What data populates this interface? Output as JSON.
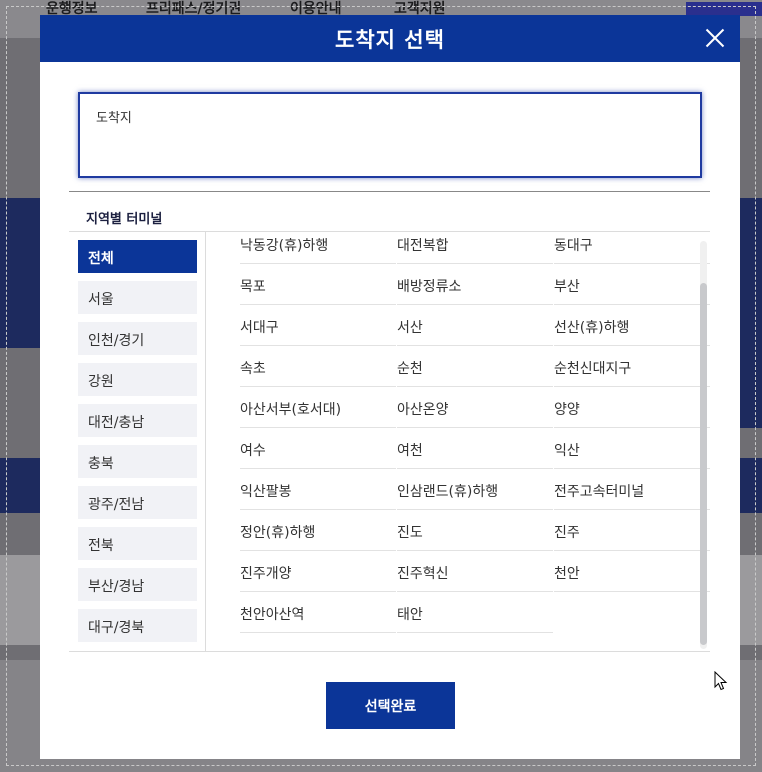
{
  "background": {
    "nav_items": [
      "운행정보",
      "프리패스/정기권",
      "이용안내",
      "고객지원"
    ]
  },
  "modal": {
    "title": "도착지 선택",
    "destination_label": "도착지",
    "section_label": "지역별 터미널",
    "regions": [
      {
        "label": "전체",
        "active": true
      },
      {
        "label": "서울",
        "active": false
      },
      {
        "label": "인천/경기",
        "active": false
      },
      {
        "label": "강원",
        "active": false
      },
      {
        "label": "대전/충남",
        "active": false
      },
      {
        "label": "충북",
        "active": false
      },
      {
        "label": "광주/전남",
        "active": false
      },
      {
        "label": "전북",
        "active": false
      },
      {
        "label": "부산/경남",
        "active": false
      },
      {
        "label": "대구/경북",
        "active": false
      }
    ],
    "terminals": [
      "낙동강(휴)하행",
      "대전복합",
      "동대구",
      "목포",
      "배방정류소",
      "부산",
      "서대구",
      "서산",
      "선산(휴)하행",
      "속초",
      "순천",
      "순천신대지구",
      "아산서부(호서대)",
      "아산온양",
      "양양",
      "여수",
      "여천",
      "익산",
      "익산팔봉",
      "인삼랜드(휴)하행",
      "전주고속터미널",
      "정안(휴)하행",
      "진도",
      "진주",
      "진주개양",
      "진주혁신",
      "천안",
      "천안아산역",
      "태안"
    ],
    "confirm_label": "선택완료"
  },
  "colors": {
    "primary": "#0b3598",
    "region_bg": "#f1f2f6"
  }
}
